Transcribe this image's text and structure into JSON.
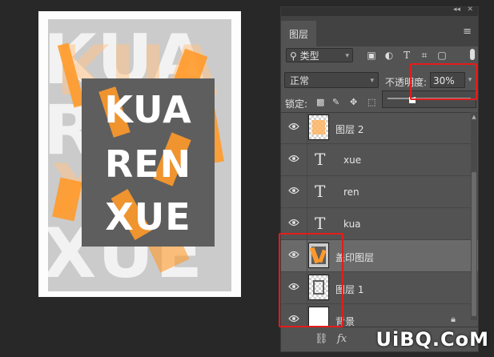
{
  "canvas": {
    "bg_words": [
      "KUA",
      "RNE",
      "XUE",
      "XUE"
    ],
    "main_words": [
      "KUA",
      "REN",
      "XUE"
    ],
    "accent_color": "#ff9a2a"
  },
  "panel": {
    "tab": "图层",
    "filter": {
      "label": "类型",
      "icon": "search-icon"
    },
    "blend_mode": "正常",
    "opacity_label": "不透明度:",
    "opacity_value": "30%",
    "opacity_fraction": 0.3,
    "lock_label": "锁定:",
    "layers": [
      {
        "name": "图层 2",
        "kind": "image",
        "selected": false
      },
      {
        "name": "xue",
        "kind": "text",
        "selected": false
      },
      {
        "name": "ren",
        "kind": "text",
        "selected": false
      },
      {
        "name": "kua",
        "kind": "text",
        "selected": false
      },
      {
        "name": "盖印图层",
        "kind": "stamp",
        "selected": true
      },
      {
        "name": "图层 1",
        "kind": "transparent",
        "selected": false
      },
      {
        "name": "背景",
        "kind": "background",
        "selected": false,
        "locked": true
      }
    ],
    "bottom": {
      "link": "link-icon",
      "fx": "fx"
    }
  },
  "watermark": "UiBQ.CoM",
  "highlight_color": "#e31c1c"
}
